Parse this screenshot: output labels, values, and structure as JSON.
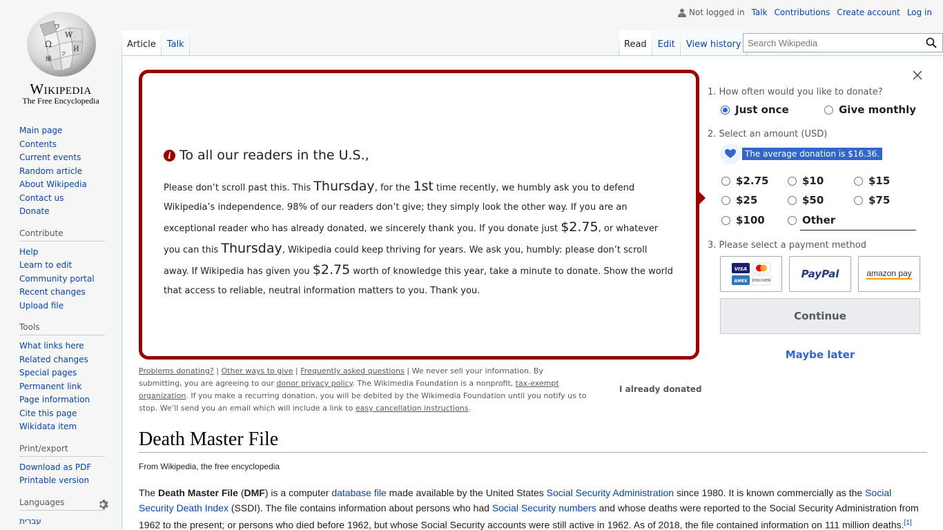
{
  "logo": {
    "wordmark": "Wikipedia",
    "tagline": "The Free Encyclopedia"
  },
  "personal": {
    "not_logged_in": "Not logged in",
    "talk": "Talk",
    "contributions": "Contributions",
    "create_account": "Create account",
    "log_in": "Log in"
  },
  "tabs": {
    "article": "Article",
    "talk": "Talk",
    "read": "Read",
    "edit": "Edit",
    "view_history": "View history"
  },
  "search": {
    "placeholder": "Search Wikipedia"
  },
  "sidebar": {
    "main": [
      "Main page",
      "Contents",
      "Current events",
      "Random article",
      "About Wikipedia",
      "Contact us",
      "Donate"
    ],
    "contribute_heading": "Contribute",
    "contribute": [
      "Help",
      "Learn to edit",
      "Community portal",
      "Recent changes",
      "Upload file"
    ],
    "tools_heading": "Tools",
    "tools": [
      "What links here",
      "Related changes",
      "Special pages",
      "Permanent link",
      "Page information",
      "Cite this page",
      "Wikidata item"
    ],
    "print_heading": "Print/export",
    "print": [
      "Download as PDF",
      "Printable version"
    ],
    "languages_heading": "Languages",
    "languages": [
      "עברית"
    ]
  },
  "banner": {
    "heading": "To all our readers in the U.S.,",
    "t1": "Please don’t scroll past this. This ",
    "day": "Thursday",
    "t2": ", for the ",
    "nth": "1st",
    "t3": " time recently, we humbly ask you to defend Wikipedia’s independence. 98% of our readers don’t give; they simply look the other way. If you are an exceptional reader who has already donated, we sincerely thank you. If you donate just ",
    "amount": "$2.75",
    "t4": ", or whatever you can this ",
    "t5": ", Wikipedia could keep thriving for years. We ask you, humbly: please don’t scroll away. If Wikipedia has given you ",
    "t6": " worth of knowledge this year, take a minute to donate. Show the world that access to reliable, neutral information matters to you. Thank you.",
    "links": {
      "problems": "Problems donating?",
      "other_ways": "Other ways to give",
      "faq": "Frequently asked questions",
      "t1": " We never sell your information. By submitting, you are agreeing to our ",
      "privacy": "donor privacy policy",
      "t2": ". The Wikimedia Foundation is a nonprofit, ",
      "tax": "tax-exempt organization",
      "t3": ". If you make a recurring donation, you will be debited by the Wikimedia Foundation until you notify us to stop. We’ll send you an email which will include a link to ",
      "cancel": "easy cancellation instructions",
      "t4": "."
    },
    "already_donated": "I already donated"
  },
  "form": {
    "step1": "1.  How often would you like to donate?",
    "just_once": "Just once",
    "give_monthly": "Give monthly",
    "frequency_selected": "Just once",
    "step2": "2.  Select an amount (USD)",
    "average": "The average donation is $16.36.",
    "amounts": [
      "$2.75",
      "$10",
      "$15",
      "$25",
      "$50",
      "$75",
      "$100",
      "Other"
    ],
    "step3": "3.  Please select a payment method",
    "pay_methods": [
      "Credit card",
      "PayPal",
      "amazon pay"
    ],
    "paypal_label": "PayPal",
    "amazon_label": "amazon pay",
    "continue": "Continue",
    "maybe_later": "Maybe later"
  },
  "article": {
    "title": "Death Master File",
    "from": "From Wikipedia, the free encyclopedia",
    "p1": "The ",
    "bold1": "Death Master File",
    "p2": " (",
    "bold2": "DMF",
    "p3": ") is a computer ",
    "link1": "database file",
    "p4": " made available by the United States ",
    "link2": "Social Security Administration",
    "p5": " since 1980. It is known commercially as the ",
    "link3": "Social Security Death Index",
    "p6": " (SSDI). The file contains information about persons who had ",
    "link4": "Social Security numbers",
    "p7": " and whose deaths were reported to the Social Security Administration from 1962 to the present; or persons who died before 1962, but whose Social Security accounts were still active in 1962. As of 2018, the file contained information on 111 million deaths.",
    "ref": "[1]"
  },
  "colors": {
    "banner_border": "#990000",
    "accent": "#3366cc",
    "link": "#0645ad"
  }
}
